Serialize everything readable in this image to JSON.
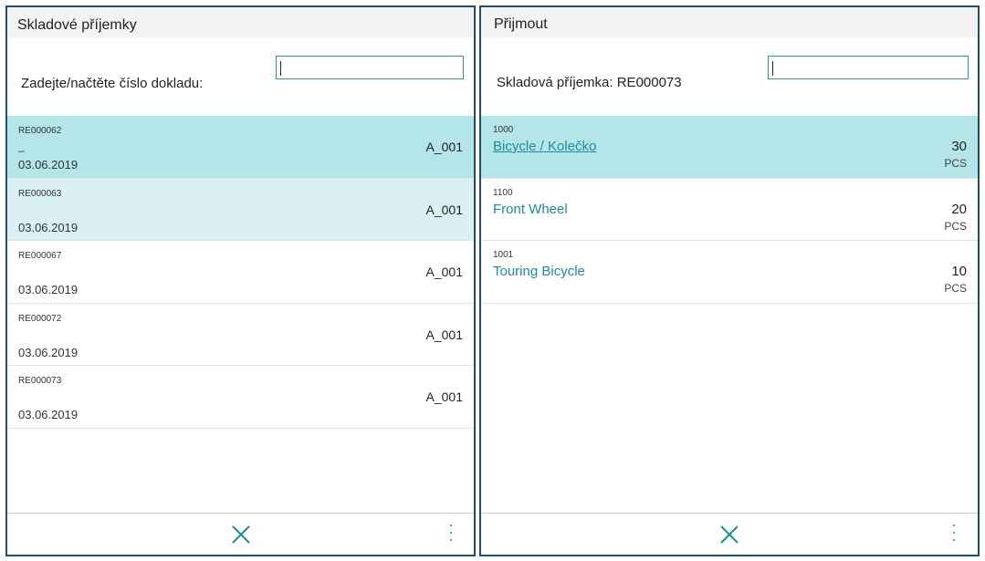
{
  "colors": {
    "accent": "#1f8c95",
    "selected_row": "#b3e5e9",
    "hover_row": "#daf0f2",
    "panel_border": "#1f4f6a"
  },
  "left_panel": {
    "title": "Skladové příjemky",
    "scan_label": "Zadejte/načtěte číslo dokladu:",
    "scan_input_value": "",
    "documents": [
      {
        "number": "RE000062",
        "extra": "_",
        "date": "03.06.2019",
        "location": "A_001"
      },
      {
        "number": "RE000063",
        "extra": "",
        "date": "03.06.2019",
        "location": "A_001"
      },
      {
        "number": "RE000067",
        "extra": "",
        "date": "03.06.2019",
        "location": "A_001"
      },
      {
        "number": "RE000072",
        "extra": "",
        "date": "03.06.2019",
        "location": "A_001"
      },
      {
        "number": "RE000073",
        "extra": "",
        "date": "03.06.2019",
        "location": "A_001"
      }
    ],
    "footer": {
      "close_icon": "close-x-icon",
      "more_icon": "more-vertical-icon"
    }
  },
  "right_panel": {
    "title": "Přijmout",
    "scan_label": "Skladová příjemka: RE000073",
    "scan_input_value": "",
    "items": [
      {
        "number": "1000",
        "description": "Bicycle / Kolečko",
        "quantity": "30",
        "uom": "PCS"
      },
      {
        "number": "1100",
        "description": "Front Wheel",
        "quantity": "20",
        "uom": "PCS"
      },
      {
        "number": "1001",
        "description": "Touring Bicycle",
        "quantity": "10",
        "uom": "PCS"
      }
    ],
    "footer": {
      "close_icon": "close-x-icon",
      "more_icon": "more-vertical-icon"
    }
  }
}
